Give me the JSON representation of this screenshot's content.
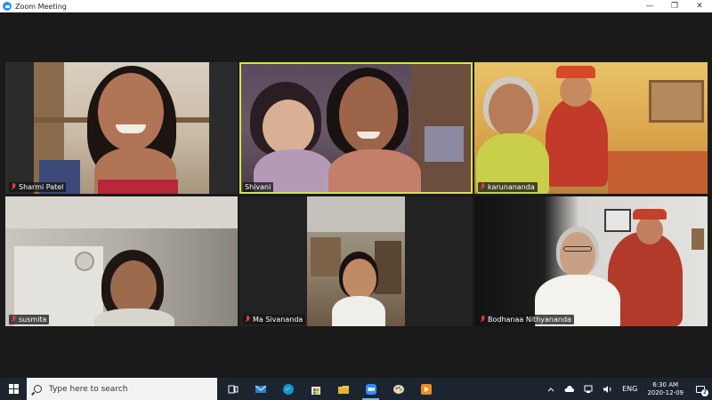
{
  "window": {
    "title": "Zoom Meeting",
    "minimize_glyph": "—",
    "maximize_glyph": "❐",
    "close_glyph": "✕"
  },
  "participants": [
    {
      "name": "Sharmi Patel",
      "muted": true,
      "active_speaker": false
    },
    {
      "name": "Shivani",
      "muted": false,
      "active_speaker": true
    },
    {
      "name": "karunananda",
      "muted": true,
      "active_speaker": false
    },
    {
      "name": "susmita",
      "muted": true,
      "active_speaker": false
    },
    {
      "name": "Ma Sivananda",
      "muted": true,
      "active_speaker": false
    },
    {
      "name": "Bodhanaa Nithyananda",
      "muted": true,
      "active_speaker": false
    }
  ],
  "taskbar": {
    "search_placeholder": "Type here to search",
    "pinned_apps": [
      "task-view",
      "mail",
      "edge",
      "store",
      "file-explorer",
      "zoom",
      "paint",
      "media-player"
    ],
    "language": "ENG",
    "time": "6:30 AM",
    "date": "2020-12-09",
    "notification_count": "2",
    "tray_icons": [
      "chevron-up",
      "cloud",
      "network",
      "volume"
    ]
  },
  "colors": {
    "active_speaker_border": "#d7e24b",
    "muted_mic": "#e0393e",
    "taskbar_bg": "#1c2430",
    "meeting_bg": "#1a1a1a"
  }
}
